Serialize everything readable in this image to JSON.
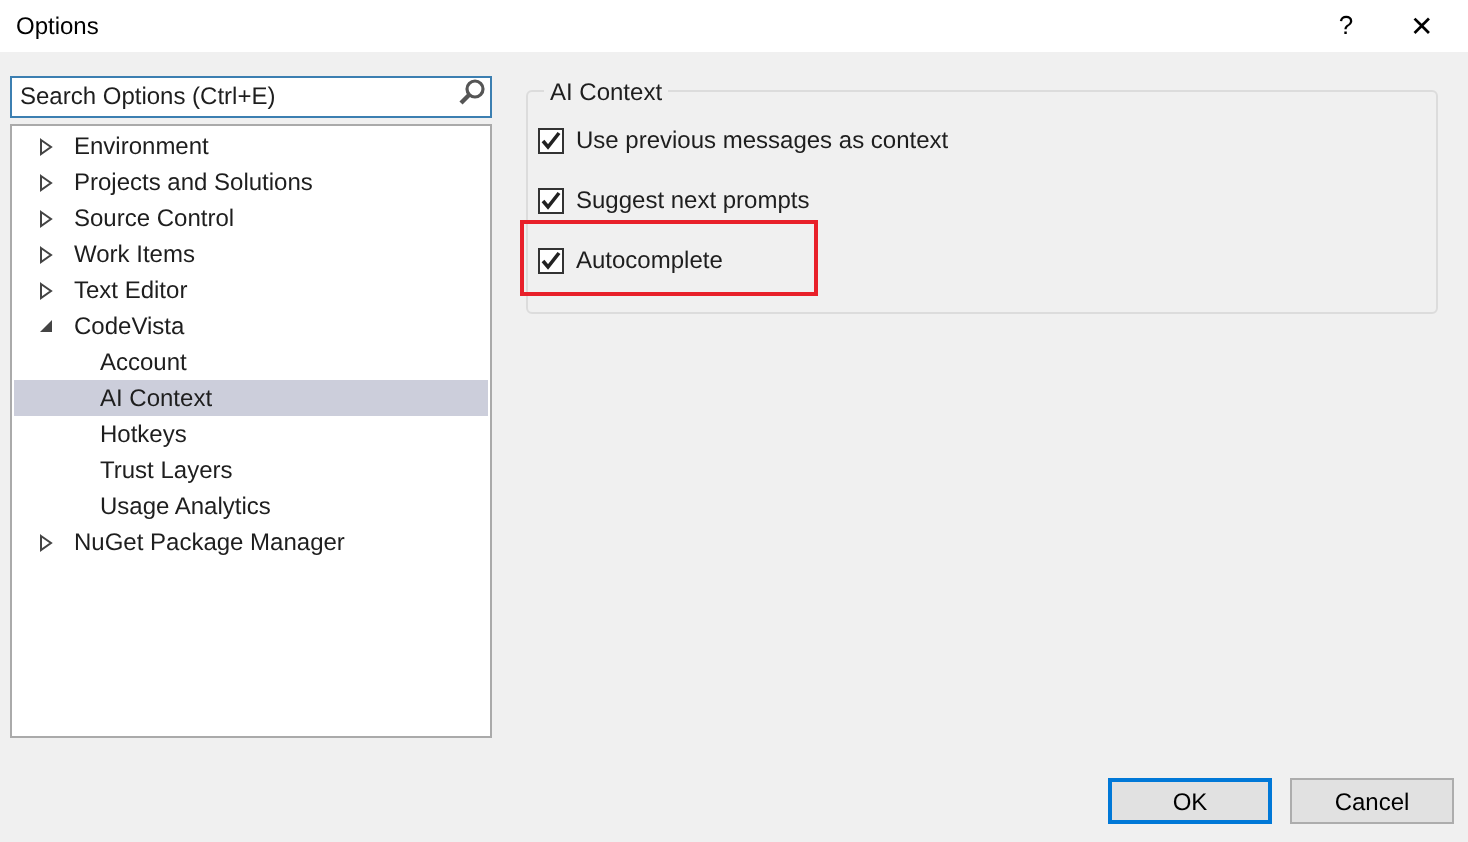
{
  "window": {
    "title": "Options",
    "help": "?",
    "close": "✕"
  },
  "search": {
    "placeholder": "Search Options (Ctrl+E)"
  },
  "tree": [
    {
      "label": "Environment",
      "expanded": false,
      "selected": false
    },
    {
      "label": "Projects and Solutions",
      "expanded": false,
      "selected": false
    },
    {
      "label": "Source Control",
      "expanded": false,
      "selected": false
    },
    {
      "label": "Work Items",
      "expanded": false,
      "selected": false
    },
    {
      "label": "Text Editor",
      "expanded": false,
      "selected": false
    },
    {
      "label": "CodeVista",
      "expanded": true,
      "selected": false,
      "children": [
        {
          "label": "Account",
          "selected": false
        },
        {
          "label": "AI Context",
          "selected": true
        },
        {
          "label": "Hotkeys",
          "selected": false
        },
        {
          "label": "Trust Layers",
          "selected": false
        },
        {
          "label": "Usage Analytics",
          "selected": false
        }
      ]
    },
    {
      "label": "NuGet Package Manager",
      "expanded": false,
      "selected": false
    }
  ],
  "group": {
    "title": "AI Context",
    "options": [
      {
        "label": "Use previous messages as context",
        "checked": true,
        "highlighted": false
      },
      {
        "label": "Suggest next prompts",
        "checked": true,
        "highlighted": false
      },
      {
        "label": "Autocomplete",
        "checked": true,
        "highlighted": true
      }
    ]
  },
  "buttons": [
    {
      "label": "OK",
      "default": true
    },
    {
      "label": "Cancel",
      "default": false
    }
  ]
}
